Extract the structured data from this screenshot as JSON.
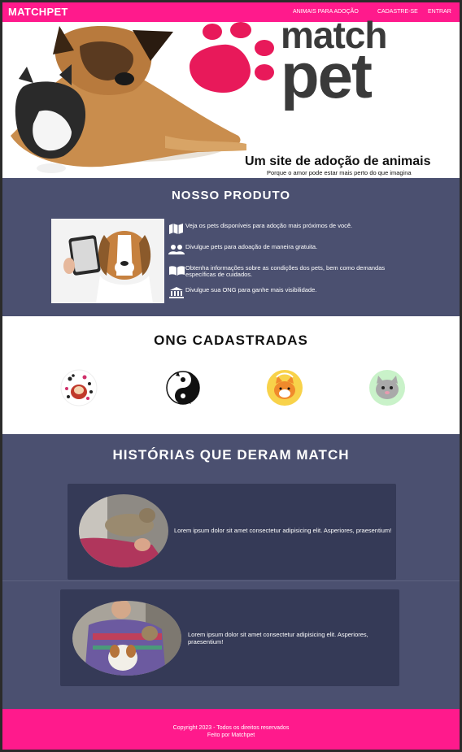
{
  "nav": {
    "brand": "MATCHPET",
    "links": [
      "ANIMAIS PARA ADOÇÃO",
      "CADASTRE-SE",
      "ENTRAR"
    ]
  },
  "hero": {
    "logo_text_top": "match",
    "logo_text_bottom": "pet",
    "title": "Um site de adoção de animais",
    "subtitle": "Porque o amor pode estar mais perto do que imagina"
  },
  "produto": {
    "title": "NOSSO PRODUTO",
    "features": [
      {
        "icon": "map-icon",
        "text": "Veja os pets disponíveis para adoção mais próximos de você."
      },
      {
        "icon": "users-icon",
        "text": "Divulgue pets para adoação de maneira gratuita."
      },
      {
        "icon": "book-icon",
        "text": "Obtenha informações sobre as condições dos pets, bem como demandas específicas de cuidados."
      },
      {
        "icon": "institution-icon",
        "text": "Divulgue sua ONG para ganhe mais visibilidade."
      }
    ]
  },
  "ong": {
    "title": "ONG CADASTRADAS"
  },
  "historias": {
    "title": "HISTÓRIAS QUE DERAM MATCH",
    "stories": [
      {
        "text": "Lorem ipsum dolor sit amet consectetur adipisicing elit. Asperiores, praesentium!"
      },
      {
        "text": "Lorem ipsum dolor sit amet consectetur adipisicing elit. Asperiores, praesentium!"
      }
    ]
  },
  "footer": {
    "copyright": "Copyright 2023 - Todos os direitos reservados",
    "made_by": "Feito por Matchpet"
  },
  "colors": {
    "brand_pink": "#ff1a8c",
    "section_blue": "#4b5070",
    "card_dark": "#353a57"
  }
}
